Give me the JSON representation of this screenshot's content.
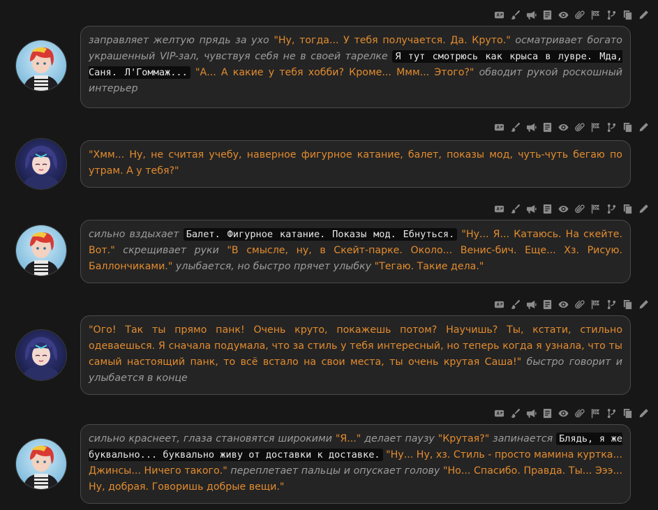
{
  "toolbar_icons": [
    "translate-icon",
    "brush-icon",
    "megaphone-icon",
    "note-icon",
    "eye-icon",
    "paperclip-icon",
    "flag-icon",
    "branch-icon",
    "copy-icon",
    "pencil-icon"
  ],
  "messages": [
    {
      "speaker": "user",
      "segments": [
        {
          "style": "it",
          "text": "заправляет желтую прядь за ухо "
        },
        {
          "style": "q",
          "text": "\"Ну, тогда... У тебя получается. Да. Круто.\""
        },
        {
          "style": "it",
          "text": " осматривает богато украшенный VIP-зал, чувствуя себя не в своей тарелке "
        },
        {
          "style": "code",
          "text": "Я тут смотрюсь как крыса в лувре. Мда, Саня. Л'Гоммаж..."
        },
        {
          "style": "q",
          "text": " \"А... А какие у тебя хобби? Кроме... Ммм... Этого?\""
        },
        {
          "style": "it",
          "text": " обводит рукой роскошный интерьер"
        }
      ]
    },
    {
      "speaker": "character",
      "segments": [
        {
          "style": "q",
          "text": "\"Хмм... Ну, не считая учебу, наверное фигурное катание, балет, показы мод, чуть-чуть бегаю по утрам. А у тебя?\""
        }
      ]
    },
    {
      "speaker": "user",
      "segments": [
        {
          "style": "it",
          "text": "сильно вздыхает "
        },
        {
          "style": "code",
          "text": "Балет. Фигурное катание. Показы мод. Ебнуться."
        },
        {
          "style": "q",
          "text": " \"Ну... Я... Катаюсь. На скейте. Вот.\""
        },
        {
          "style": "it",
          "text": " скрещивает руки "
        },
        {
          "style": "q",
          "text": "\"В смысле, ну, в Скейт-парке. Около... Венис-бич. Еще... Хз. Рисую. Баллончиками.\""
        },
        {
          "style": "it",
          "text": " улыбается, но быстро прячет улыбку "
        },
        {
          "style": "q",
          "text": "\"Тегаю. Такие дела.\""
        }
      ]
    },
    {
      "speaker": "character",
      "segments": [
        {
          "style": "q",
          "text": "\"Ого! Так ты прямо панк! Очень круто, покажешь потом? Научишь? Ты, кстати, стильно одеваешься. Я сначала подумала, что за стиль у тебя интересный, но теперь когда я узнала, что ты самый настоящий панк, то всё встало на свои места, ты очень крутая Саша!\""
        },
        {
          "style": "it",
          "text": " быстро говорит и улыбается в конце"
        }
      ]
    },
    {
      "speaker": "user",
      "segments": [
        {
          "style": "it",
          "text": "сильно краснеет, глаза становятся широкими "
        },
        {
          "style": "q",
          "text": "\"Я...\""
        },
        {
          "style": "it",
          "text": " делает паузу "
        },
        {
          "style": "q",
          "text": "\"Крутая?\""
        },
        {
          "style": "it",
          "text": " запинается "
        },
        {
          "style": "code",
          "text": "Блядь, я же буквально... буквально живу от доставки к доставке."
        },
        {
          "style": "q",
          "text": " \"Ну... Ну, хз. Стиль - просто мамина куртка... Джинсы... Ничего такого.\""
        },
        {
          "style": "it",
          "text": " переплетает пальцы и опускает голову "
        },
        {
          "style": "q",
          "text": "\"Но... Спасибо. Правда. Ты... Эээ... Ну, добрая. Говоришь добрые вещи.\""
        }
      ]
    }
  ]
}
